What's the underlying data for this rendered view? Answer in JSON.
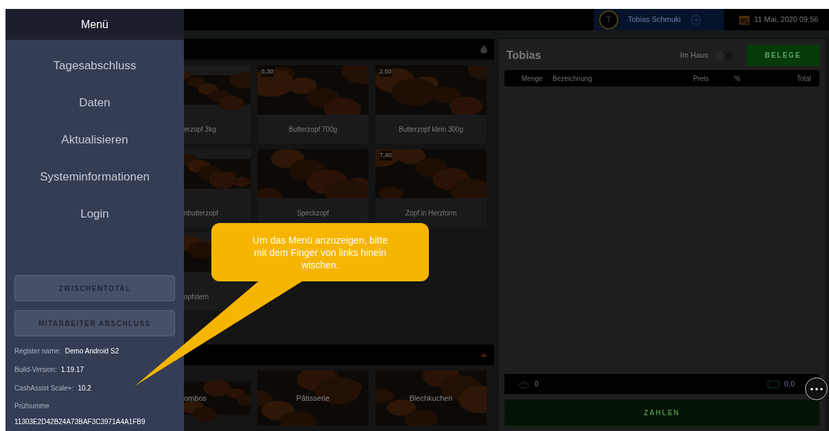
{
  "menu": {
    "title": "Menü",
    "items": [
      "Tagesabschluss",
      "Daten",
      "Aktualisieren",
      "Systeminformationen",
      "Login"
    ],
    "buttons": [
      "ZWISCHENTOTAL",
      "MITARBEITER ABSCHLUSS"
    ],
    "info": [
      {
        "label": "Register name:",
        "value": "Demo Android S2"
      },
      {
        "label": "Build-Version:",
        "value": "1.19.17"
      },
      {
        "label": "CashAssist Scale+:",
        "value": "10.2"
      }
    ],
    "checksum": {
      "label": "Prüfsumme",
      "value": "11303E2D42B24A73BAF3C3971A4A1FB9"
    }
  },
  "top_bar": {
    "user_initial": "T",
    "user_name": "Tobias Schmuki",
    "datetime": "11 Mai, 2020 09:56"
  },
  "products": [
    {
      "label": "erzopf 3kg"
    },
    {
      "price": "5,30",
      "label": "Butterzopf 700g"
    },
    {
      "price": "2,50",
      "label": "Butterzopf klein 300g"
    },
    {
      "label": "nbutterzopf"
    },
    {
      "label": "Speckzopf"
    },
    {
      "price": "7,40",
      "label": "Zopf in Herzform"
    },
    {
      "label": "opfstern"
    }
  ],
  "categories": [
    "ombos",
    "Pâtisserie",
    "Blechkuchen"
  ],
  "order": {
    "title": "Tobias",
    "im_haus": {
      "label": "Im Haus",
      "on": false
    },
    "receipts_button": "BELEGE",
    "columns": [
      "Menge",
      "Bezeichnung",
      "Preis",
      "%",
      "Total"
    ],
    "count": "0",
    "total": "0,0",
    "pay_button": "ZAHLEN"
  },
  "hint": {
    "text": "Um das Menü anzuzeigen, bitte mit dem Finger von links hinein wischen."
  }
}
